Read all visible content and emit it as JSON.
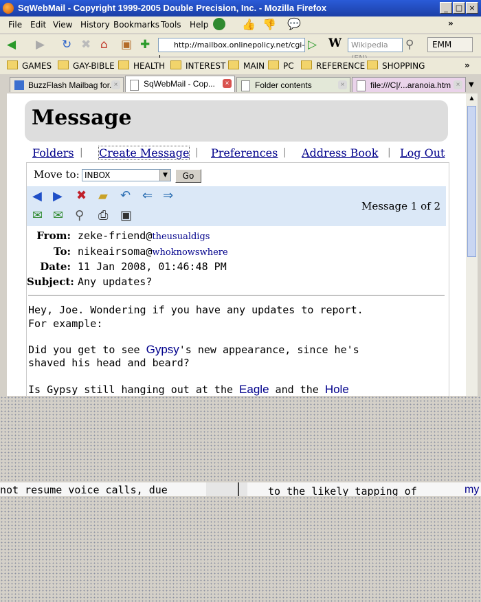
{
  "window": {
    "title": "SqWebMail - Copyright 1999-2005 Double Precision, Inc. - Mozilla Firefox",
    "controls": [
      "_",
      "□",
      "×"
    ]
  },
  "menu": [
    "File",
    "Edit",
    "View",
    "History",
    "Bookmarks",
    "Tools",
    "Help"
  ],
  "nav": {
    "url": "http://mailbox.onlinepolicy.net/cgi-l",
    "search_placeholder": "Wikipedia (EN)",
    "emm_label": "EMM"
  },
  "bookmarks": [
    "GAMES",
    "GAY-BIBLE",
    "HEALTH",
    "INTEREST",
    "MAIN",
    "PC",
    "REFERENCE",
    "SHOPPING"
  ],
  "tabs": [
    "BuzzFlash Mailbag for...",
    "SqWebMail - Cop...",
    "Folder contents",
    "file:///C|/...aranoia.htm"
  ],
  "page": {
    "heading": "Message",
    "links": [
      "Folders",
      "Create Message",
      "Preferences",
      "Address Book",
      "Log Out"
    ],
    "move_to_label": "Move to:",
    "folder_value": "INBOX",
    "go_label": "Go",
    "message_count": "Message 1 of 2",
    "headers": {
      "from_label": "From:",
      "from_user": "zeke-friend@",
      "from_domain": "theusualdigs",
      "to_label": "To:",
      "to_user": "nikeairsoma@",
      "to_domain": "whoknowswhere",
      "date_label": "Date:",
      "date_value": "11 Jan 2008, 01:46:48 PM",
      "subject_label": "Subject:",
      "subject_value": "Any updates?"
    },
    "body": {
      "line1": "Hey, Joe. Wondering if you have any updates to report.",
      "line2": "For example:",
      "line3a": "Did you get to see ",
      "line3_link": "Gypsy",
      "line3b": "'s new appearance, since he's",
      "line4": "shaved his head and beard?",
      "line5a": "Is Gypsy still hanging out at the ",
      "line5_link1": "Eagle",
      "line5b": " and the ",
      "line5_link2": "Hole"
    },
    "fragment_left": "not resume voice calls, due",
    "fragment_right": "to the likely tapping of",
    "fragment_link": "my"
  }
}
